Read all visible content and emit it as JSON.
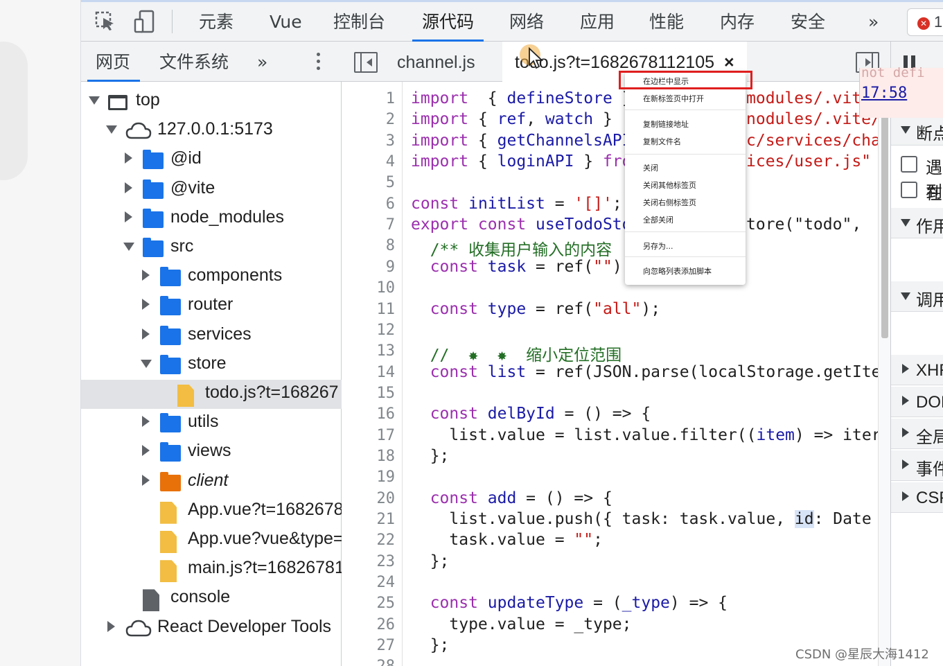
{
  "toolbar": {
    "tabs": [
      "元素",
      "Vue",
      "控制台",
      "源代码",
      "网络",
      "应用",
      "性能",
      "内存",
      "安全"
    ],
    "active_tab": "源代码",
    "more": "»",
    "error_count": "1",
    "icons": [
      "inspect-element-icon",
      "device-toolbar-icon",
      "error-icon"
    ]
  },
  "navigator": {
    "tabs": [
      "网页",
      "文件系统"
    ],
    "more": "»",
    "tree": [
      {
        "label": "top",
        "depth": 0,
        "icon": "frame",
        "expanded": true
      },
      {
        "label": "127.0.0.1:5173",
        "depth": 1,
        "icon": "cloud",
        "expanded": true
      },
      {
        "label": "@id",
        "depth": 2,
        "icon": "folder",
        "expanded": false
      },
      {
        "label": "@vite",
        "depth": 2,
        "icon": "folder",
        "expanded": false
      },
      {
        "label": "node_modules",
        "depth": 2,
        "icon": "folder",
        "expanded": false
      },
      {
        "label": "src",
        "depth": 2,
        "icon": "folder",
        "expanded": true
      },
      {
        "label": "components",
        "depth": 3,
        "icon": "folder",
        "expanded": false
      },
      {
        "label": "router",
        "depth": 3,
        "icon": "folder",
        "expanded": false
      },
      {
        "label": "services",
        "depth": 3,
        "icon": "folder",
        "expanded": false
      },
      {
        "label": "store",
        "depth": 3,
        "icon": "folder",
        "expanded": true
      },
      {
        "label": "todo.js?t=168267",
        "depth": 4,
        "icon": "file",
        "selected": true
      },
      {
        "label": "utils",
        "depth": 3,
        "icon": "folder",
        "expanded": false
      },
      {
        "label": "views",
        "depth": 3,
        "icon": "folder",
        "expanded": false
      },
      {
        "label": "client",
        "depth": 3,
        "icon": "folder-orange",
        "expanded": false,
        "italic": true
      },
      {
        "label": "App.vue?t=1682678",
        "depth": 3,
        "icon": "file"
      },
      {
        "label": "App.vue?vue&type=",
        "depth": 3,
        "icon": "file"
      },
      {
        "label": "main.js?t=16826781",
        "depth": 3,
        "icon": "file"
      },
      {
        "label": "console",
        "depth": 2,
        "icon": "file-gray"
      },
      {
        "label": "React Developer Tools",
        "depth": 1,
        "icon": "cloud",
        "expanded": false
      }
    ]
  },
  "editor": {
    "tabs": [
      {
        "label": "channel.js",
        "active": false
      },
      {
        "label": "todo.js?t=1682678112105",
        "active": true
      }
    ],
    "close_glyph": "×",
    "line_numbers": [
      "1",
      "2",
      "3",
      "4",
      "5",
      "6",
      "7",
      "8",
      "9",
      "10",
      "11",
      "12",
      "13",
      "14",
      "15",
      "16",
      "17",
      "18",
      "19",
      "20",
      "21",
      "22",
      "23",
      "24",
      "25",
      "26",
      "27",
      "28"
    ],
    "lines": [
      [
        [
          "k",
          "import"
        ],
        [
          "",
          "  { "
        ],
        [
          "f",
          "defineStore"
        ],
        [
          "",
          " } "
        ]
      ],
      [
        [
          "k",
          "import"
        ],
        [
          "",
          " { "
        ],
        [
          "f",
          "ref"
        ],
        [
          "",
          ", "
        ],
        [
          "f",
          "watch"
        ],
        [
          "",
          " } "
        ]
      ],
      [
        [
          "k",
          "import"
        ],
        [
          "",
          " { "
        ],
        [
          "f",
          "getChannelsAPI"
        ]
      ],
      [
        [
          "k",
          "import"
        ],
        [
          "",
          " { "
        ],
        [
          "f",
          "loginAPI"
        ],
        [
          "",
          " } "
        ],
        [
          "k",
          "fro"
        ]
      ],
      [],
      [
        [
          "k",
          "const "
        ],
        [
          "f",
          "initList"
        ],
        [
          "",
          " = "
        ],
        [
          "s",
          "'[]'"
        ],
        [
          "",
          ";"
        ]
      ],
      [
        [
          "k",
          "export const "
        ],
        [
          "f",
          "useTodoSto"
        ]
      ],
      [
        [
          "c",
          "  /** 收集用户输入的内容"
        ]
      ],
      [
        [
          "k",
          "  const "
        ],
        [
          "f",
          "task"
        ],
        [
          "",
          " = ref("
        ],
        [
          "s",
          "\"\""
        ],
        [
          "",
          ")"
        ]
      ],
      [],
      [
        [
          "k",
          "  const "
        ],
        [
          "f",
          "type"
        ],
        [
          "",
          " = ref("
        ],
        [
          "s",
          "\"all\""
        ],
        [
          "",
          ");"
        ]
      ],
      [],
      [
        [
          "c",
          "  //  ✸  ✸  缩小定位范围"
        ]
      ],
      [
        [
          "k",
          "  const "
        ],
        [
          "f",
          "list"
        ],
        [
          "",
          " = ref(JSON.parse(localStorage.getIte"
        ]
      ],
      [],
      [
        [
          "k",
          "  const "
        ],
        [
          "f",
          "delById"
        ],
        [
          "",
          " = () => {"
        ]
      ],
      [
        [
          "",
          "    list.value = list.value.filter(("
        ],
        [
          "f",
          "item"
        ],
        [
          "",
          ") => iter"
        ]
      ],
      [
        [
          "",
          "  };"
        ]
      ],
      [],
      [
        [
          "k",
          "  const "
        ],
        [
          "f",
          "add"
        ],
        [
          "",
          " = () => {"
        ]
      ],
      [
        [
          "",
          "    list.value.push({ task: task.value, "
        ],
        [
          "hl",
          "id"
        ],
        [
          "",
          ": Date"
        ]
      ],
      [
        [
          "",
          "    task.value = "
        ],
        [
          "s",
          "\"\""
        ],
        [
          "",
          ";"
        ]
      ],
      [
        [
          "",
          "  };"
        ]
      ],
      [],
      [
        [
          "k",
          "  const "
        ],
        [
          "f",
          "updateType"
        ],
        [
          "",
          " = ("
        ],
        [
          "f",
          "_type"
        ],
        [
          "",
          ") => {"
        ]
      ],
      [
        [
          "",
          "    type.value = _type;"
        ]
      ],
      [
        [
          "",
          "  };"
        ]
      ],
      []
    ],
    "right_fragments": [
      {
        "line": 1,
        "text": "modules/.vit"
      },
      {
        "line": 2,
        "text": "nodules/.vite/"
      },
      {
        "line": 3,
        "text": "c/services/cha"
      },
      {
        "line": 4,
        "text": "ices/user.js\""
      },
      {
        "line": 7,
        "text": "tore(\"todo\", "
      }
    ]
  },
  "context_menu": {
    "groups": [
      [
        "在边栏中显示",
        "在新标签页中打开"
      ],
      [
        "复制链接地址",
        "复制文件名"
      ],
      [
        "关闭",
        "关闭其他标签页",
        "关闭右侧标签页",
        "全部关闭"
      ],
      [
        "另存为..."
      ],
      [
        "向忽略列表添加脚本"
      ]
    ],
    "highlighted": "在边栏中显示"
  },
  "debugger": {
    "time_muted": "not defi",
    "time": "17:58",
    "sections": [
      {
        "label": "断点",
        "expanded": true
      },
      {
        "label": "作用",
        "expanded": true
      },
      {
        "label": "调用",
        "expanded": true
      },
      {
        "label": "XHR",
        "expanded": false
      },
      {
        "label": "DOM",
        "expanded": false
      },
      {
        "label": "全局",
        "expanded": false
      },
      {
        "label": "事件",
        "expanded": false
      },
      {
        "label": "CSP",
        "expanded": false
      }
    ],
    "checkboxes": [
      "遇到",
      "在"
    ]
  },
  "watermark": "CSDN @星辰大海1412"
}
